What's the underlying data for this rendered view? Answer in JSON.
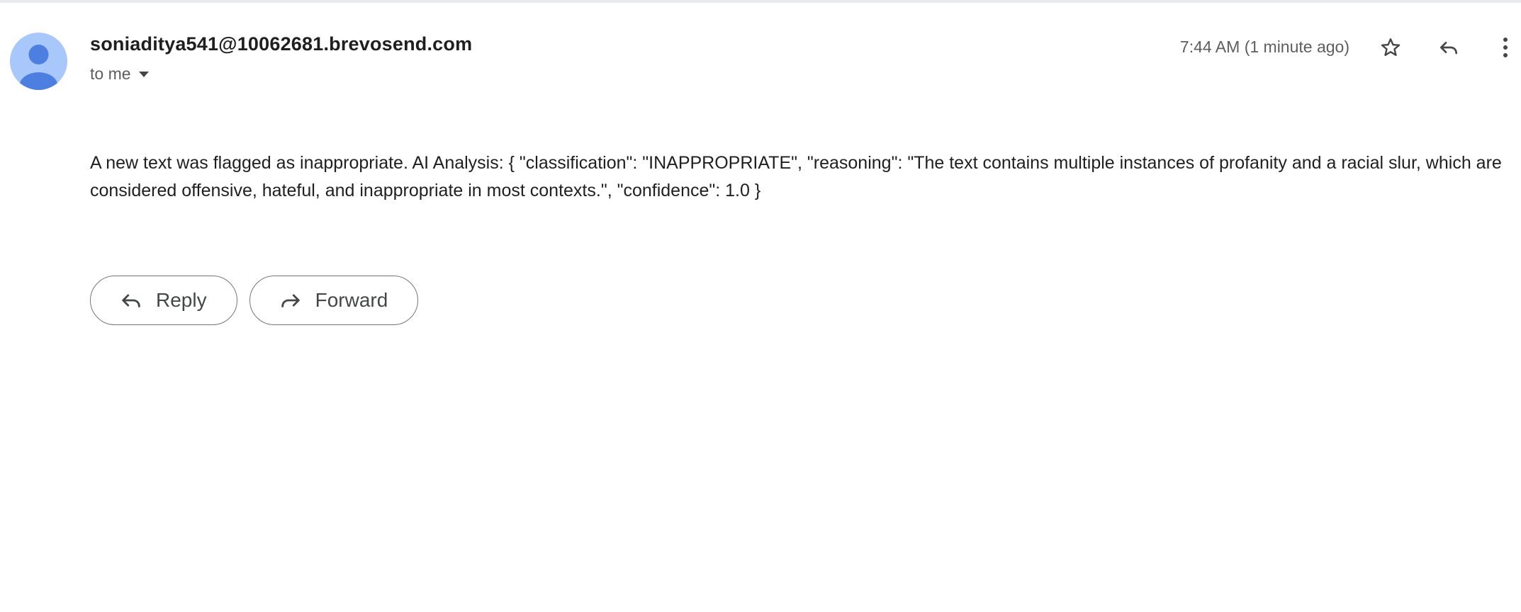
{
  "message": {
    "sender": "soniaditya541@10062681.brevosend.com",
    "recipient_label": "to me",
    "timestamp": "7:44 AM (1 minute ago)",
    "body": "A new text was flagged as inappropriate. AI Analysis: { \"classification\": \"INAPPROPRIATE\", \"reasoning\": \"The text contains multiple instances of profanity and a racial slur, which are considered offensive, hateful, and inappropriate in most contexts.\", \"confidence\": 1.0 }"
  },
  "actions": {
    "reply_label": "Reply",
    "forward_label": "Forward"
  },
  "icons": {
    "avatar": "person-icon",
    "recipient_toggle": "caret-down-icon",
    "star": "star-icon",
    "reply": "reply-icon",
    "more": "more-vert-icon",
    "forward": "forward-icon"
  },
  "colors": {
    "avatar_bg": "#a8c7fa",
    "avatar_fg": "#4d7fe0",
    "text_primary": "#1f1f1f",
    "text_secondary": "#5e5e5e",
    "pill_border": "#747775"
  }
}
